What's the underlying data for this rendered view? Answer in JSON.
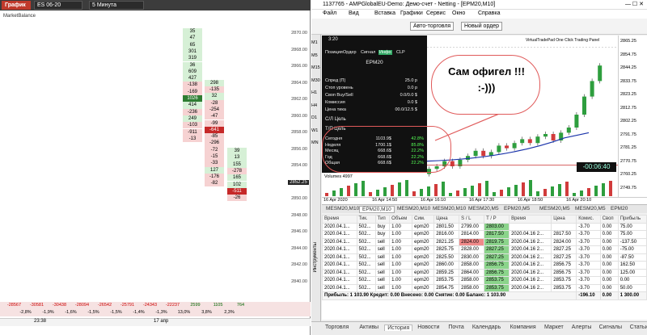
{
  "left": {
    "tabs": {
      "chart": "График",
      "symbol": "ES 06-20",
      "interval": "5 Минута"
    },
    "market_balance": "MarketBalance",
    "prices": [
      "2870.00",
      "2868.00",
      "2866.00",
      "2864.00",
      "2862.00",
      "2860.00",
      "2858.00",
      "2856.00",
      "2854.00",
      "2852.25",
      "2850.00",
      "2848.00",
      "2846.00",
      "2844.00",
      "2842.00",
      "2840.00"
    ],
    "col1": [
      "35",
      "47",
      "65",
      "301",
      "319",
      "36",
      "609",
      "427",
      "-138",
      "-169",
      "1026",
      "414",
      "-236",
      "249",
      "-103",
      "-911",
      "-13"
    ],
    "col2": [
      "298",
      "-135",
      "32",
      "-28",
      "-254",
      "-47",
      "-99",
      "-641",
      "-85",
      "-296",
      "-72",
      "-15",
      "-33",
      "127",
      "-176",
      "-82"
    ],
    "col3": [
      "39",
      "13",
      "155",
      "-278",
      "165",
      "102",
      "-511",
      "-26"
    ],
    "current_price": "2852.25",
    "footer_top": [
      "-28567",
      "-30581",
      "-30438",
      "-28094",
      "-26542",
      "-25791",
      "-24343",
      "-22237",
      "2599",
      "1105",
      "764"
    ],
    "footer_bottom": [
      "-2,8%",
      "-1,9%",
      "-1,6%",
      "-1,5%",
      "-1,5%",
      "-1,4%",
      "-1,3%",
      "13,0%",
      "3,8%",
      "2,3%"
    ],
    "time_a": "23:38",
    "time_b": "17 апр"
  },
  "title": "1137765 - AMPGlobalEU-Demo: Демо-счет - Netting - [EPM20,M10]",
  "menu": [
    "Файл",
    "Вид",
    "Вставка",
    "Графики",
    "Сервис",
    "Окно",
    "Справка"
  ],
  "toolbar": {
    "algo": "Авто-торговля",
    "new_order": "Новый ордер"
  },
  "side_tf": [
    "M1",
    "M5",
    "M15",
    "M30",
    "H1",
    "H4",
    "D1",
    "W1",
    "MN"
  ],
  "panel": {
    "time": "3:20",
    "tabs": [
      "Позиция",
      "Ордер",
      "Сигнал",
      "Инфо",
      "CLP"
    ],
    "symbol": "EPM20",
    "rows": [
      {
        "l": "Спред (П)",
        "v": "25.0 р"
      },
      {
        "l": "Стоп уровень",
        "v": "0.0 р"
      },
      {
        "l": "Своп Buy/Sell",
        "v": "0.0/0.0 $"
      },
      {
        "l": "Комиссия",
        "v": "0.0 $"
      },
      {
        "l": "Цена тика",
        "v": "00.0/12.5 $"
      }
    ],
    "sl_label": "С/Л Цель",
    "tp_label": "Т/П Цель",
    "stats": [
      {
        "l": "Сегодня",
        "v": "1103.9$",
        "p": "42.8%"
      },
      {
        "l": "Неделя",
        "v": "1700.1$",
        "p": "85.8%"
      },
      {
        "l": "Месяц",
        "v": "668.6$",
        "p": "22.2%"
      },
      {
        "l": "Год",
        "v": "668.6$",
        "p": "22.2%"
      },
      {
        "l": "Общая",
        "v": "668.6$",
        "p": "22.2%"
      }
    ]
  },
  "chart": {
    "vtp_label": "VirtualTradePad One Click Trading Panel",
    "callout_line1": "Сам офигел !!!",
    "callout_line2": ":-)))",
    "timer": "-00:06:40",
    "volume_label": "Volumes 4997",
    "price_scale": [
      "2865.25",
      "2854.75",
      "2844.25",
      "2833.75",
      "2823.25",
      "2812.75",
      "2802.25",
      "2791.75",
      "2781.25",
      "2770.75",
      "2760.25",
      "2749.75"
    ],
    "time_axis": [
      "16 Apr 2020",
      "16 Apr 14:50",
      "16 Apr 16:10",
      "16 Apr 17:30",
      "16 Apr 18:50",
      "16 Apr 20:10"
    ],
    "candles": [
      {
        "o": 2764,
        "c": 2768
      },
      {
        "o": 2768,
        "c": 2770
      },
      {
        "o": 2770,
        "c": 2774
      },
      {
        "o": 2774,
        "c": 2770
      },
      {
        "o": 2770,
        "c": 2775
      },
      {
        "o": 2775,
        "c": 2778
      },
      {
        "o": 2778,
        "c": 2782
      },
      {
        "o": 2782,
        "c": 2778
      },
      {
        "o": 2778,
        "c": 2781
      },
      {
        "o": 2781,
        "c": 2786
      },
      {
        "o": 2786,
        "c": 2784
      },
      {
        "o": 2784,
        "c": 2788
      },
      {
        "o": 2788,
        "c": 2791
      },
      {
        "o": 2791,
        "c": 2788
      },
      {
        "o": 2788,
        "c": 2793
      },
      {
        "o": 2793,
        "c": 2795
      },
      {
        "o": 2795,
        "c": 2790
      },
      {
        "o": 2790,
        "c": 2796
      },
      {
        "o": 2796,
        "c": 2800
      },
      {
        "o": 2800,
        "c": 2810
      },
      {
        "o": 2810,
        "c": 2824
      },
      {
        "o": 2824,
        "c": 2836
      },
      {
        "o": 2836,
        "c": 2848
      }
    ]
  },
  "data_tabs": [
    "MESM20,M10",
    "EPM20,M10",
    "MESM20,M10",
    "MESM20,M10",
    "MESM20,M5",
    "EPM20,M5",
    "MESM20,M5",
    "MESM20,M5",
    "EPM20"
  ],
  "data_tab_active": 1,
  "trades": {
    "headers": [
      "Время",
      "Тик.",
      "Тип",
      "Объем",
      "Сим.",
      "Цена",
      "S / L",
      "T / P",
      "Время",
      "Цена",
      "Комис.",
      "Своп",
      "Прибыль"
    ],
    "rows": [
      [
        "2020.04.1...",
        "502...",
        "buy",
        "1.00",
        "epm20",
        "2801.50",
        "2799.00",
        "2803.00",
        "",
        "",
        "-3.70",
        "0.00",
        "75.00"
      ],
      [
        "2020.04.1...",
        "502...",
        "buy",
        "1.00",
        "epm20",
        "2816.00",
        "2814.00",
        "2817.50",
        "2020.04.16 2...",
        "2817.50",
        "-3.70",
        "0.00",
        "75.00"
      ],
      [
        "2020.04.1...",
        "502...",
        "sell",
        "1.00",
        "epm20",
        "2821.25",
        "2824.00",
        "2819.75",
        "2020.04.16 2...",
        "2824.00",
        "-3.70",
        "0.00",
        "-137.50"
      ],
      [
        "2020.04.1...",
        "502...",
        "sell",
        "1.00",
        "epm20",
        "2825.75",
        "2828.00",
        "2827.25",
        "2020.04.16 2...",
        "2827.25",
        "-3.70",
        "0.00",
        "-75.00"
      ],
      [
        "2020.04.1...",
        "502...",
        "sell",
        "1.00",
        "epm20",
        "2825.50",
        "2830.00",
        "2827.25",
        "2020.04.16 2...",
        "2827.25",
        "-3.70",
        "0.00",
        "-87.50"
      ],
      [
        "2020.04.1...",
        "502...",
        "sell",
        "1.00",
        "epm20",
        "2860.00",
        "2858.00",
        "2856.75",
        "2020.04.16 2...",
        "2856.75",
        "-3.70",
        "0.00",
        "162.50"
      ],
      [
        "2020.04.1...",
        "502...",
        "sell",
        "1.00",
        "epm20",
        "2859.25",
        "2864.00",
        "2856.75",
        "2020.04.16 2...",
        "2856.75",
        "-3.70",
        "0.00",
        "125.00"
      ],
      [
        "2020.04.1...",
        "502...",
        "sell",
        "1.00",
        "epm20",
        "2853.75",
        "2858.00",
        "2853.75",
        "2020.04.16 2...",
        "2853.75",
        "-3.70",
        "0.00",
        "0.00"
      ],
      [
        "2020.04.1...",
        "502...",
        "sell",
        "1.00",
        "epm20",
        "2854.75",
        "2858.00",
        "2853.75",
        "2020.04.16 2...",
        "2853.75",
        "-3.70",
        "0.00",
        "50.00"
      ]
    ],
    "summary": "Прибыль: 1 103.90  Кредит: 0.00  Внесено: 0.00  Снятие: 0.00  Баланс: 1 103.90",
    "summary_commission": "-196.10",
    "summary_swap": "0.00",
    "summary_profit": "1 300.00"
  },
  "side_label": "Инструменты",
  "bottom_tabs": [
    "Торговля",
    "Активы",
    "История",
    "Новости",
    "Почта",
    "Календарь",
    "Компания",
    "Маркет",
    "Алерты",
    "Сигналы",
    "Статьи"
  ],
  "bottom_tab_active": 2
}
